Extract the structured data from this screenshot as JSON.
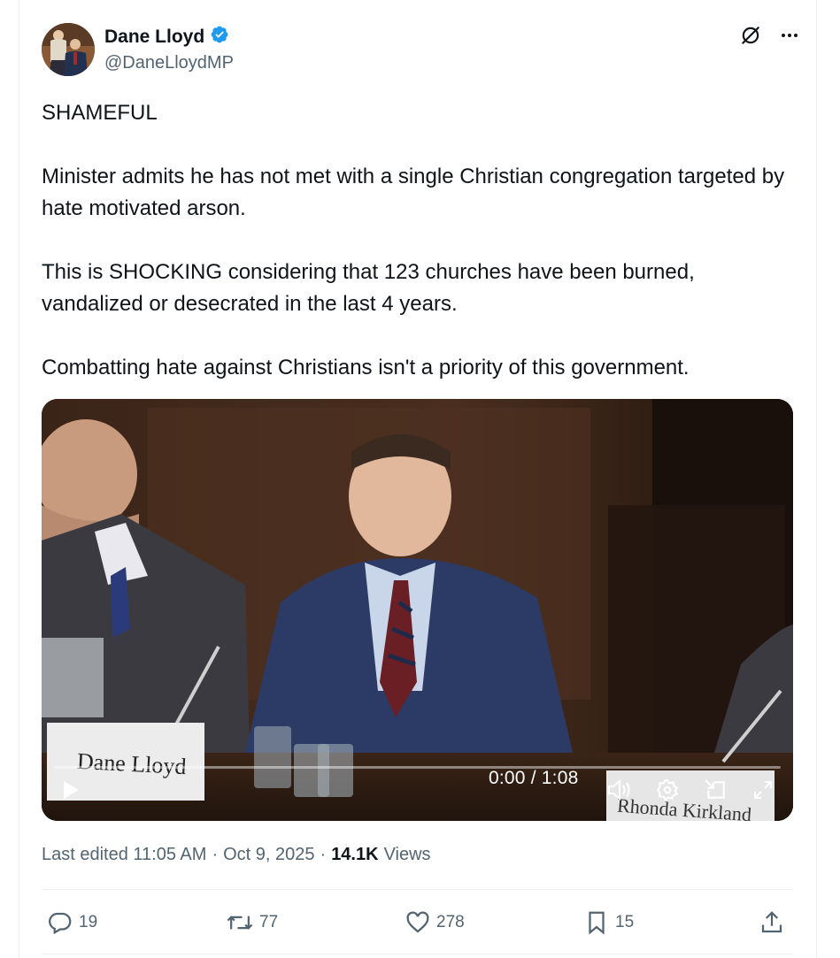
{
  "author": {
    "display_name": "Dane Lloyd",
    "handle": "@DaneLloydMP",
    "verified": true,
    "verified_color": "#1d9bf0"
  },
  "header_icons": [
    "grok-icon",
    "more-icon"
  ],
  "tweet": {
    "paragraphs": [
      "SHAMEFUL",
      "Minister admits he has not met with a single Christian congregation targeted by hate motivated arson.",
      "This is SHOCKING considering that 123 churches have been burned, vandalized or desecrated in the last 4 years.",
      "Combatting hate against Christians isn't a priority of this government."
    ]
  },
  "video": {
    "nameplate_left": "Dane Lloyd",
    "nameplate_right": "Rhonda Kirkland",
    "timecode": "0:00 / 1:08",
    "progress": 0,
    "controls": [
      "play-icon",
      "volume-icon",
      "settings-icon",
      "pip-icon",
      "fullscreen-icon"
    ]
  },
  "meta": {
    "edited": "Last edited 11:05 AM",
    "date": "Oct 9, 2025",
    "views_count": "14.1K",
    "views_label": "Views"
  },
  "actions": {
    "replies": "19",
    "reposts": "77",
    "likes": "278",
    "bookmarks": "15"
  }
}
